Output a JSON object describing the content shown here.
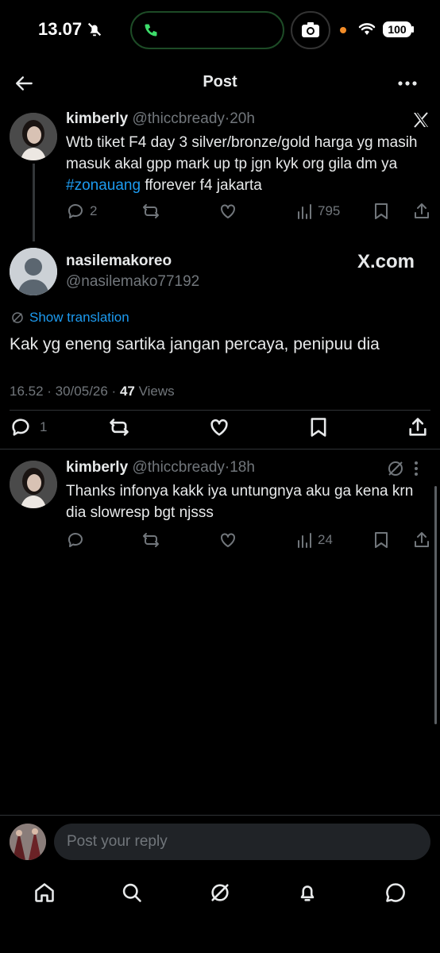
{
  "status_bar": {
    "time": "13.07",
    "battery": "100"
  },
  "header": {
    "title": "Post"
  },
  "parent_tweet": {
    "display_name": "kimberly",
    "handle": "@thiccbready",
    "time_sep": "·",
    "time": "20h",
    "text_before": "Wtb tiket F4 day 3 silver/bronze/gold harga yg masih masuk akal gpp mark up tp jgn kyk org gila dm ya ",
    "hashtag": "#zonauang",
    "text_after": " fforever f4 jakarta",
    "replies": "2",
    "views": "795"
  },
  "main_tweet": {
    "display_name": "nasilemakoreo",
    "handle": "@nasilemako77192",
    "watermark": "X.com",
    "translation_label": "Show translation",
    "text": "Kak yg eneng sartika jangan percaya, penipuu dia",
    "time_date": "16.52 · 30/05/26 ·",
    "views_count": "47",
    "views_label": "Views",
    "replies": "1"
  },
  "reply_tweet": {
    "display_name": "kimberly",
    "handle": "@thiccbready",
    "time_sep": "·",
    "time": "18h",
    "text": "Thanks infonya kakk iya untungnya aku ga kena krn dia slowresp bgt njsss",
    "views": "24"
  },
  "composer": {
    "placeholder": "Post your reply"
  },
  "colors": {
    "accent": "#1d9bf0",
    "muted": "#71767b",
    "text": "#e7e9ea",
    "background": "#000000"
  }
}
